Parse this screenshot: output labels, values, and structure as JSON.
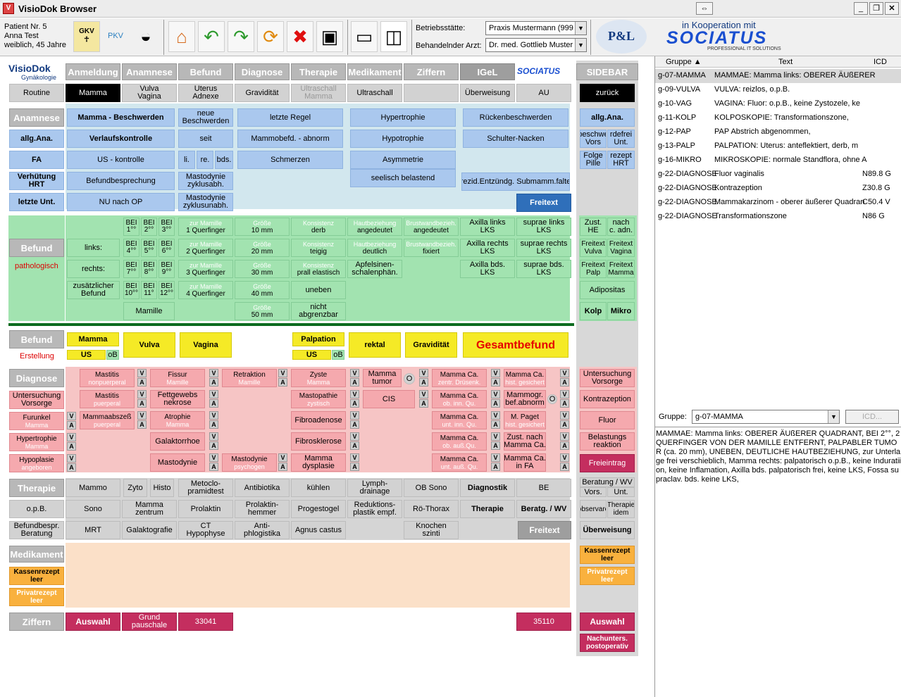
{
  "title": "VisioDok Browser",
  "patient": {
    "nr": "Patient Nr. 5",
    "name": "Anna Test",
    "info": "weiblich, 45 Jahre"
  },
  "toolbar": {
    "gkv": "GKV",
    "pkv": "PKV",
    "betrieb_label": "Betriebsstätte:",
    "betrieb": "Praxis Mustermann (999",
    "arzt_label": "Behandelnder Arzt:",
    "arzt": "Dr. med. Gottlieb Muster",
    "koop": "in Kooperation mit",
    "soc": "SOCIATUS",
    "soc_sub": "PROFESSIONAL IT SOLUTIONS",
    "pl": "P&L"
  },
  "logo": {
    "name": "VisioDok",
    "sub": "Gynäkologie",
    "soc": "SOCIATUS"
  },
  "tabs": [
    "Anmeldung",
    "Anamnese",
    "Befund",
    "Diagnose",
    "Therapie",
    "Medikament",
    "Ziffern",
    "IGeL"
  ],
  "sidebar_title": "SIDEBAR",
  "subtabs": [
    "Routine",
    "Mamma",
    "Vulva\nVagina",
    "Uterus\nAdnexe",
    "Gravidität",
    "Ultraschall\nMamma",
    "Ultraschall",
    "",
    "Überweisung",
    "AU"
  ],
  "zurueck": "zurück",
  "anamnese": {
    "label": "Anamnese",
    "left": [
      "allg.Ana.",
      "FA",
      "Verhütung\nHRT",
      "letzte Unt."
    ],
    "col2": [
      "Mamma - Beschwerden",
      "Verlaufskontrolle",
      "US - kontrolle",
      "Befundbesprechung",
      "NU nach OP"
    ],
    "col3": [
      "neue\nBeschwerden",
      "seit",
      "li.",
      "re.",
      "bds.",
      "Mastodynie\nzyklusabh.",
      "Mastodynie\nzyklusunabh."
    ],
    "col4": [
      "letzte Regel",
      "Mammobefd. - abnorm",
      "Schmerzen"
    ],
    "col5": [
      "Hypertrophie",
      "Hypotrophie",
      "Asymmetrie",
      "seelisch belastend"
    ],
    "col6": [
      "Rückenbeschwerden",
      "Schulter-Nacken",
      "rezid.Entzündg. Submamm.falte",
      "Freitext"
    ]
  },
  "sb_ana": [
    "allg.Ana.",
    "beschwe\nVors",
    "rdefrei\nUnt.",
    "Folge\nPille",
    "rezept\nHRT"
  ],
  "befund": {
    "label": "Befund",
    "patho": "pathologisch",
    "links": "links:",
    "rechts": "rechts:",
    "zus": "zusätzlicher\nBefund",
    "bei": [
      [
        "BEI\n1°°",
        "BEI\n2°°",
        "BEI\n3°°"
      ],
      [
        "BEI\n4°°",
        "BEI\n5°°",
        "BEI\n6°°"
      ],
      [
        "BEI\n7°°",
        "BEI\n8°°",
        "BEI\n9°°"
      ],
      [
        "BEI\n10°°",
        "BEI\n11°",
        "BEI\n12°°"
      ]
    ],
    "quer": [
      [
        "zur Mamille",
        "1 Querfinger"
      ],
      [
        "zur Mamille",
        "2 Querfinger"
      ],
      [
        "zur Mamille",
        "3 Querfinger"
      ],
      [
        "zur Mamille",
        "4 Querfinger"
      ]
    ],
    "mamille": "Mamille",
    "groesse": [
      [
        "Größe",
        "10 mm"
      ],
      [
        "Größe",
        "20 mm"
      ],
      [
        "Größe",
        "30 mm"
      ],
      [
        "Größe",
        "40 mm"
      ],
      [
        "Größe",
        "50 mm"
      ]
    ],
    "konsistenz": [
      [
        "Konsistenz",
        "derb"
      ],
      [
        "Konsistenz",
        "teigig"
      ],
      [
        "Konsistenz",
        "prall elastisch"
      ],
      [
        "",
        "uneben"
      ],
      [
        "",
        "nicht\nabgrenzbar"
      ]
    ],
    "haut": [
      [
        "Hautbeziehung",
        "angedeutet"
      ],
      [
        "Hautbeziehung",
        "deutlich"
      ],
      [
        "",
        "Apfelsinen-\nschalenphän."
      ]
    ],
    "brust": [
      [
        "Brustwandbezieh.",
        "angedeutet"
      ],
      [
        "Brustwandbezieh.",
        "fixiert"
      ]
    ],
    "axilla": [
      "Axilla links\nLKS",
      "Axilla rechts\nLKS",
      "Axilla bds.\nLKS"
    ],
    "supra": [
      "suprae links\nLKS",
      "suprae rechts\nLKS",
      "suprae bds.\nLKS"
    ]
  },
  "sb_bef": [
    "Zust.\nHE",
    "nach\nc. adn.",
    "Freitext\nVulva",
    "Freitext\nVagina",
    "Freitext\nPalp",
    "Freitext\nMamma",
    "Adipositas",
    "Kolp",
    "Mikro"
  ],
  "erst": {
    "label": "Befund",
    "sub": "Erstellung",
    "mamma": "Mamma",
    "us": "US",
    "ob": "oB",
    "vulva": "Vulva",
    "vagina": "Vagina",
    "palp": "Palpation",
    "us2": "US",
    "ob2": "oB",
    "rektal": "rektal",
    "grav": "Gravidität",
    "gesamt": "Gesamtbefund"
  },
  "diagnose": {
    "label": "Diagnose",
    "left": [
      "Untersuchung\nVorsorge",
      "Furunkel",
      "Hypertrophie",
      "Hypoplasie"
    ],
    "left_sub": [
      "",
      "Mamma",
      "Mamma",
      "angeboren"
    ],
    "c2": [
      [
        "Mastitis",
        "nonpuerperal"
      ],
      [
        "Mastitis",
        "puerperal"
      ],
      [
        "Mammaabszeß",
        "puerperal"
      ]
    ],
    "c3": [
      [
        "Fissur",
        "Mamille"
      ],
      [
        "Fettgewebs\nnekrose",
        ""
      ],
      [
        "Atrophie",
        "Mamma"
      ],
      [
        "Galaktorrhoe",
        ""
      ],
      [
        "Mastodynie",
        ""
      ]
    ],
    "c4": [
      [
        "Retraktion",
        "Mamille"
      ],
      [
        "Mastodynie",
        "psychogen"
      ]
    ],
    "c5": [
      [
        "Zyste",
        "Mamma"
      ],
      [
        "Mastopathie",
        "zystisch"
      ],
      [
        "Fibroadenose",
        ""
      ],
      [
        "Fibrosklerose",
        ""
      ],
      [
        "Mamma\ndysplasie",
        ""
      ]
    ],
    "c6": [
      [
        "Mamma\ntumor",
        ""
      ],
      [
        "CIS",
        ""
      ]
    ],
    "c7": [
      [
        "Mamma Ca.",
        "zentr. Drüsenk."
      ],
      [
        "Mamma Ca.",
        "ob. inn. Qu."
      ],
      [
        "Mamma Ca.",
        "unt. inn. Qu."
      ],
      [
        "Mamma Ca.",
        "ob. auß.Qu."
      ],
      [
        "Mamma Ca.",
        "unt. auß. Qu."
      ]
    ],
    "c8": [
      [
        "Mamma Ca.",
        "hist. gesichert"
      ],
      [
        "Mammogr.\nbef.abnorm",
        ""
      ],
      [
        "M. Paget",
        "hist. gesichert"
      ],
      [
        "Zust. nach\nMamma Ca.",
        ""
      ],
      [
        "Mamma Ca.\nin FA",
        ""
      ]
    ],
    "o": "O"
  },
  "sb_diag": [
    "Untersuchung\nVorsorge",
    "Kontrazeption",
    "Fluor",
    "Belastungs\nreaktion",
    "Freieintrag"
  ],
  "therapie": {
    "label": "Therapie",
    "rows": [
      [
        "Mammo",
        "Zyto",
        "Histo",
        "Metoclo-\npramidtest",
        "Antibiotika",
        "kühlen",
        "Lymph-\ndrainage",
        "OB Sono",
        "Diagnostik",
        "BE"
      ],
      [
        "o.p.B.",
        "Sono",
        "Mamma\nzentrum",
        "Prolaktin",
        "Prolaktin-\nhemmer",
        "Progestogel",
        "Reduktions-\nplastik empf.",
        "Rö-Thorax",
        "Therapie",
        "Beratg. / WV"
      ],
      [
        "Befundbespr.\nBeratung",
        "MRT",
        "Galaktografie",
        "CT\nHypophyse",
        "Anti-\nphlogistika",
        "Agnus castus",
        "Knochen\nszinti",
        "",
        "Freitext"
      ]
    ]
  },
  "sb_ther": [
    "Beratung / WV",
    "Vors.",
    "Unt.",
    "observare",
    "Therapie\nidem",
    "Überweisung"
  ],
  "medikament": {
    "label": "Medikament",
    "kasse": "Kassenrezept\nleer",
    "privat": "Privatrezept\nleer"
  },
  "sb_med": [
    "Kassenrezept\nleer",
    "Privatrezept\nleer"
  ],
  "ziffern": {
    "label": "Ziffern",
    "auswahl": "Auswahl",
    "grund": "Grund\npauschale",
    "z1": "33041",
    "z2": "35110"
  },
  "sb_zif": [
    "Auswahl",
    "Nachunters.\npostoperativ"
  ],
  "grid": {
    "h": [
      "Gruppe ▲",
      "Text",
      "ICD"
    ],
    "rows": [
      [
        "g-07-MAMMA",
        "MAMMAE: Mamma links: OBERER ÄUßERER",
        ""
      ],
      [
        "g-09-VULVA",
        "VULVA: reizlos, o.p.B.",
        ""
      ],
      [
        "g-10-VAG",
        "VAGINA: Fluor: o.p.B., keine Zystozele, ke",
        ""
      ],
      [
        "g-11-KOLP",
        "KOLPOSKOPIE: Transformationszone,",
        ""
      ],
      [
        "g-12-PAP",
        "PAP Abstrich abgenommen,",
        ""
      ],
      [
        "g-13-PALP",
        "PALPATION: Uterus: anteflektiert, derb, m",
        ""
      ],
      [
        "g-16-MIKRO",
        "MIKROSKOPIE: normale Standflora, ohne A",
        ""
      ],
      [
        "g-22-DIAGNOSE",
        "Fluor vaginalis",
        "N89.8 G"
      ],
      [
        "g-22-DIAGNOSE",
        "Kontrazeption",
        "Z30.8 G"
      ],
      [
        "g-22-DIAGNOSE",
        "Mammakarzinom - oberer äußerer Quadran",
        "C50.4 V"
      ],
      [
        "g-22-DIAGNOSE",
        "Transformationszone",
        "N86 G"
      ]
    ]
  },
  "gruppe": {
    "label": "Gruppe:",
    "value": "g-07-MAMMA",
    "icd": "ICD...",
    "text": "MAMMAE: Mamma links: OBERER ÄUßERER QUADRANT, BEI 2°°, 2 QUERFINGER VON DER MAMILLE ENTFERNT, PALPABLER TUMOR (ca. 20 mm), UNEBEN, DEUTLICHE HAUTBEZIEHUNG, zur Unterlage frei verschieblich, Mamma rechts: palpatorisch o.p.B., keine Induratiion, keine Inflamation, Axilla bds. palpatorisch frei, keine LKS, Fossa supraclav. bds. keine LKS,"
  }
}
